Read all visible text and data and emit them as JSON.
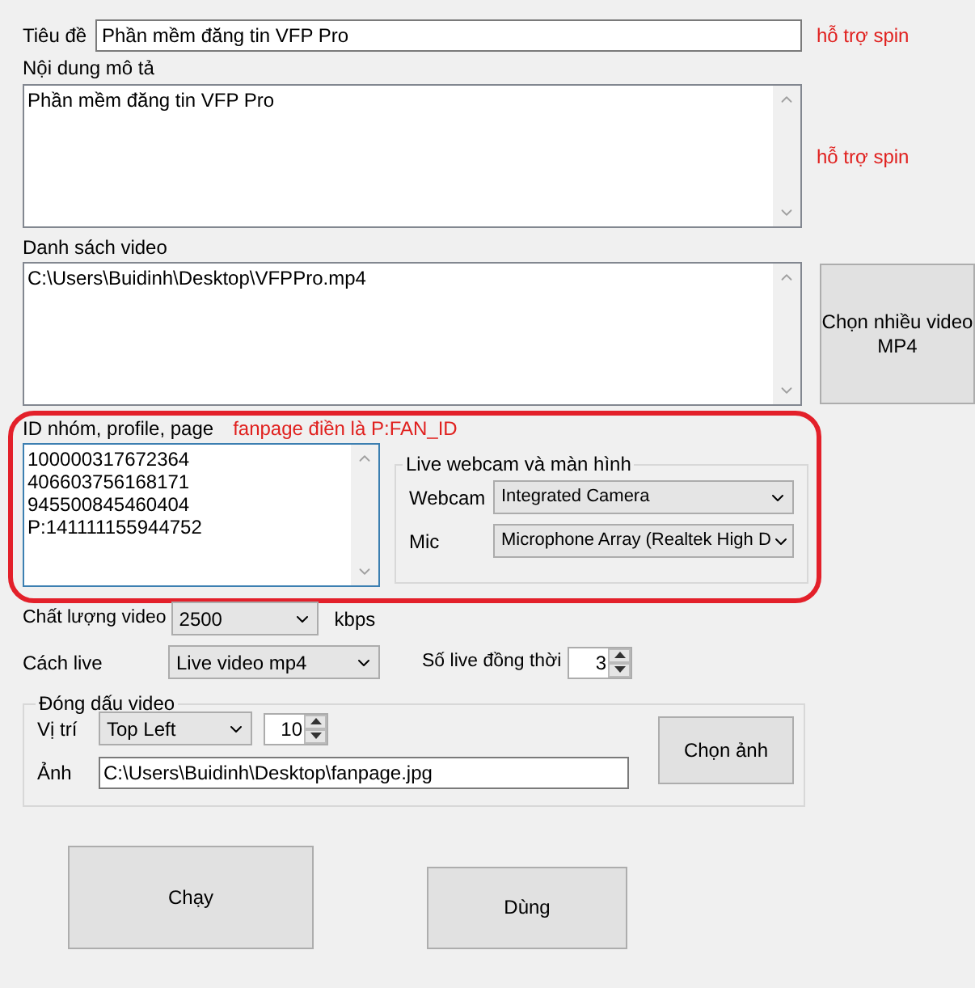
{
  "title_field": {
    "label": "Tiêu đề",
    "value": "Phần mềm đăng tin VFP Pro",
    "hint": "hỗ trợ spin"
  },
  "description": {
    "label": "Nội dung mô tả",
    "lines": [
      "Phần mềm đăng tin VFP Pro"
    ],
    "hint": "hỗ trợ spin"
  },
  "video_list": {
    "label": "Danh sách video",
    "lines": [
      "C:\\Users\\Buidinh\\Desktop\\VFPPro.mp4"
    ],
    "button": "Chọn nhiều video MP4"
  },
  "ids": {
    "label": "ID nhóm, profile, page",
    "note": "fanpage điền là P:FAN_ID",
    "focused": true,
    "lines": [
      "100000317672364",
      "406603756168171",
      "945500845460404",
      "P:141111155944752"
    ]
  },
  "live_group": {
    "title": "Live webcam và màn hình",
    "rows": [
      {
        "label": "Webcam",
        "value": "Integrated Camera"
      },
      {
        "label": "Mic",
        "value": "Microphone Array (Realtek High D"
      }
    ]
  },
  "quality": {
    "label": "Chất lượng video",
    "value": "2500",
    "unit": "kbps"
  },
  "live_mode": {
    "label": "Cách live",
    "value": "Live video mp4"
  },
  "concurrent": {
    "label": "Số live đồng thời",
    "value": "3"
  },
  "watermark_group": {
    "title": "Đóng dấu video",
    "position_label": "Vị trí",
    "position": "Top Left",
    "size": "10",
    "image_label": "Ảnh",
    "image_path": "C:\\Users\\Buidinh\\Desktop\\fanpage.jpg",
    "button": "Chọn ảnh"
  },
  "buttons": [
    "Chạy",
    "Dùng"
  ]
}
